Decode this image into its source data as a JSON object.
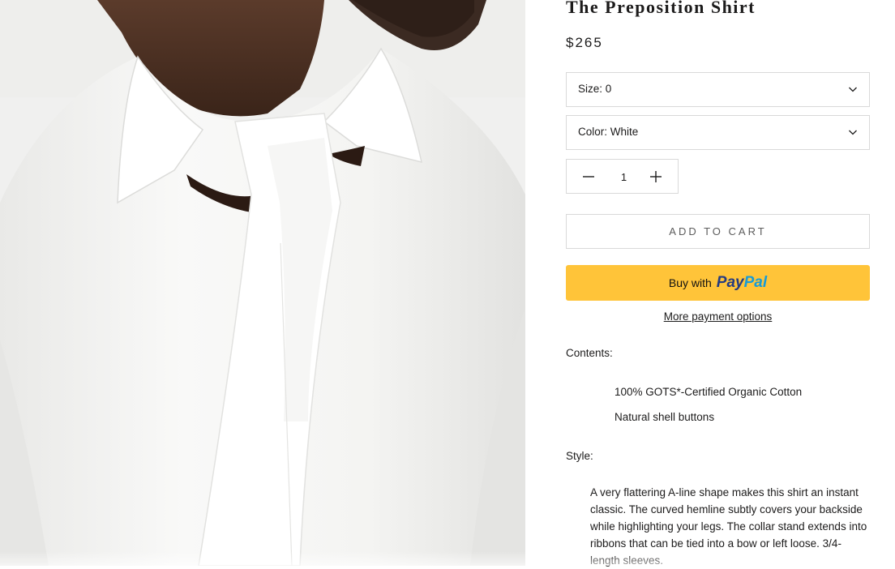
{
  "product": {
    "title": "The Preposition Shirt",
    "price": "$265",
    "image_alt": "Close-up of a white cotton shirt with collar ribbons"
  },
  "size_select": {
    "label": "Size:",
    "value": "0",
    "text": "Size: 0",
    "icon": "chevron-down-icon"
  },
  "color_select": {
    "label": "Color:",
    "value": "White",
    "text": "Color: White",
    "icon": "chevron-down-icon"
  },
  "quantity": {
    "value": "1",
    "decrease_icon": "minus-icon",
    "increase_icon": "plus-icon"
  },
  "buttons": {
    "add_to_cart": "ADD TO CART",
    "buy_with": "Buy with",
    "paypal_part1": "Pay",
    "paypal_part2": "Pal",
    "more_payment_options": "More payment options"
  },
  "contents": {
    "label": "Contents:",
    "items": [
      "100% GOTS*-Certified Organic Cotton",
      "Natural shell buttons"
    ]
  },
  "style": {
    "label": "Style:",
    "description": "A very flattering A-line shape makes this shirt an instant classic. The curved hemline subtly covers your backside while highlighting your legs. The collar stand extends into ribbons that can be tied into a bow or left loose. 3/4-length sleeves."
  },
  "colors": {
    "paypal_yellow": "#ffc439",
    "paypal_dark_blue": "#253b80",
    "paypal_light_blue": "#179bd7",
    "border_gray": "#d9d9d9",
    "text_dark": "#1c1b1b"
  }
}
